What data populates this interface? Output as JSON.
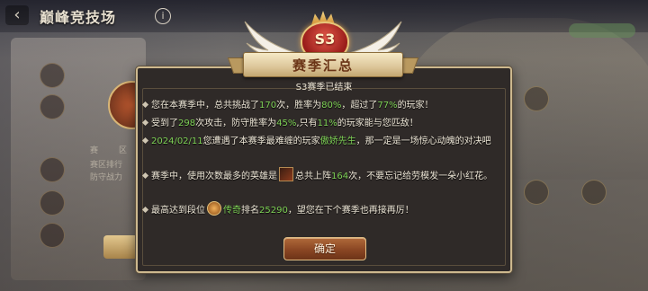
{
  "page": {
    "title": "巅峰竞技场",
    "back_icon": "back-arrow-icon",
    "info_icon_glyph": "i"
  },
  "background": {
    "labels": [
      "赛",
      "区",
      "赛区排行",
      "防守战力"
    ]
  },
  "dialog": {
    "emblem_text": "S3",
    "banner_title": "赛季汇总",
    "subtitle": "S3赛季已结束",
    "line1": {
      "a": "您在本赛季中，总共挑战了",
      "challenges": "170",
      "b": "次，胜率为",
      "win_rate": "80%",
      "c": "，超过了",
      "beat_pct": "77%",
      "d": "的玩家！"
    },
    "line2": {
      "attacked": "298",
      "a": "受到了",
      "b": "次攻击，防守胜率为",
      "def_rate": "45%",
      "c": ",只有",
      "match_pct": "11%",
      "d": "的玩家能与您匹敌！"
    },
    "line3": {
      "date": "2024/02/11",
      "a": "您遭遇了本赛季最难缠的玩家",
      "rival": "傲娇先生",
      "b": "，那一定是一场惊心动魄的对决吧"
    },
    "line4": {
      "a": "赛季中，使用次数最多的英雄是",
      "b": "总共上阵",
      "count": "164",
      "c": "次，不要忘记给劳模发一朵小红花。"
    },
    "line5": {
      "a": "最高达到段位",
      "tier": "传奇",
      "b": "排名",
      "rank": "25290",
      "c": "，望您在下个赛季也再接再厉！"
    },
    "confirm_label": "确定",
    "colors": {
      "highlight_green": "#7fd257",
      "frame_gold": "#cdb88e",
      "panel_dark": "#2f2a28"
    },
    "icons": [
      "hero-portrait-icon",
      "rank-tier-icon"
    ]
  }
}
